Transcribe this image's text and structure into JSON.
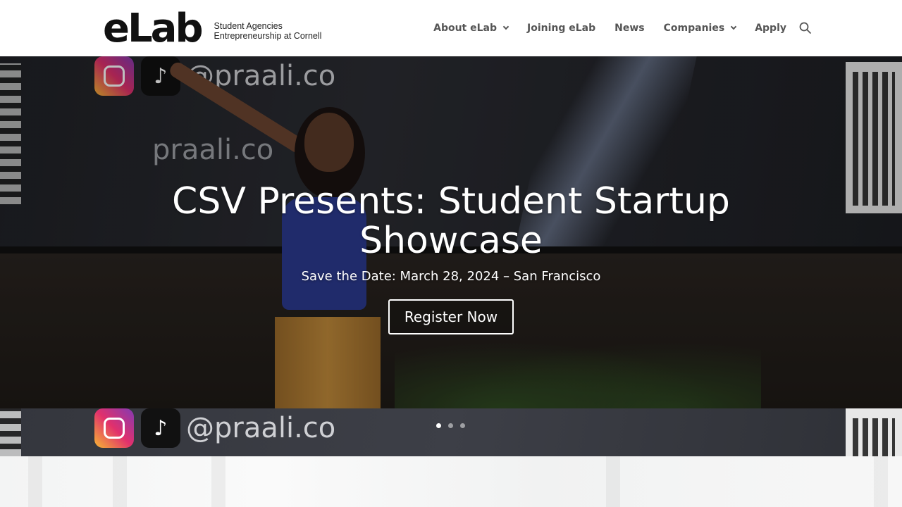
{
  "header": {
    "logo_word": "eLab",
    "logo_tag_line1": "Student Agencies",
    "logo_tag_line2": "Entrepreneurship at Cornell",
    "nav": [
      {
        "label": "About eLab",
        "dropdown": true
      },
      {
        "label": "Joining eLab",
        "dropdown": false
      },
      {
        "label": "News",
        "dropdown": false
      },
      {
        "label": "Companies",
        "dropdown": true
      },
      {
        "label": "Apply",
        "dropdown": false
      }
    ],
    "search_icon": "search-icon"
  },
  "hero": {
    "handle": "@praali.co",
    "brand_text": "praali.co",
    "title": "CSV Presents: Student Startup Showcase",
    "subtitle": "Save the Date: March 28, 2024 – San Francisco",
    "button_label": "Register Now",
    "slides_total": 3,
    "active_slide": 1
  },
  "next_slide": {
    "handle": "@praali.co"
  }
}
